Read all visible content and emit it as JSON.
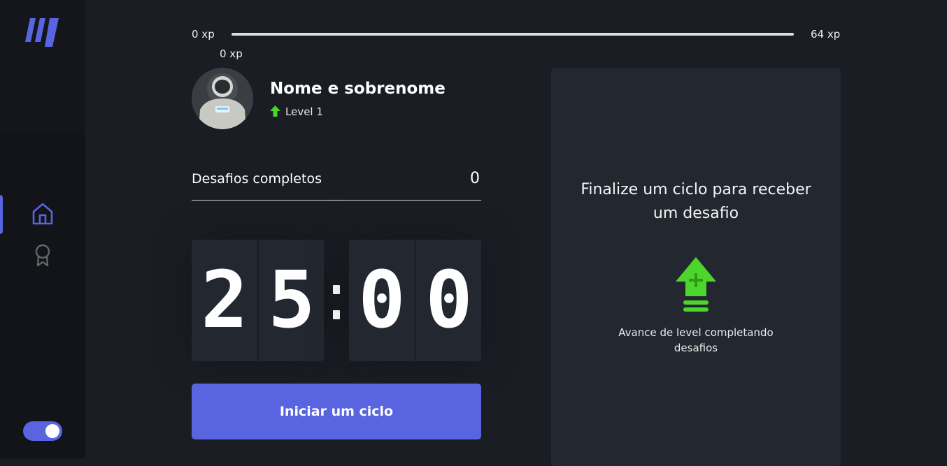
{
  "colors": {
    "accent": "#5965e0",
    "level_green": "#4cd62b",
    "background": "#1a1d24",
    "panel": "#232830",
    "sidebar": "#121419"
  },
  "sidebar": {
    "logo_icon": "logo-icon",
    "items": [
      {
        "icon": "home-icon",
        "active": true
      },
      {
        "icon": "award-icon",
        "active": false
      }
    ],
    "theme_toggle": {
      "state": "on"
    }
  },
  "experience": {
    "min_label": "0 xp",
    "max_label": "64 xp",
    "current_label": "0 xp",
    "progress_fraction": 0
  },
  "profile": {
    "name": "Nome e sobrenome",
    "level": "Level 1",
    "level_icon": "level-up-arrow-icon"
  },
  "challenges": {
    "label": "Desafios completos",
    "value": "0"
  },
  "countdown": {
    "minute_digits": [
      "2",
      "5"
    ],
    "second_digits": [
      "0",
      "0"
    ]
  },
  "actions": {
    "start_label": "Iniciar um ciclo"
  },
  "challenge_box": {
    "title": "Finalize um ciclo para receber um desafio",
    "icon": "level-up-icon",
    "hint": "Avance de level completando desafios"
  }
}
